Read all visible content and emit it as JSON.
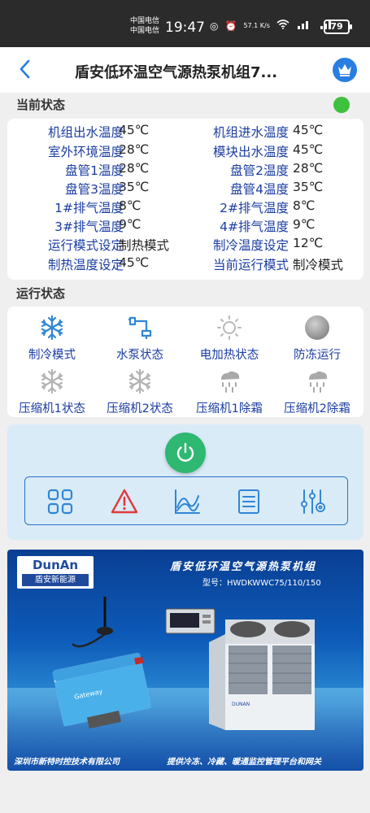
{
  "statusbar": {
    "carrier1": "中国电信",
    "carrier2": "中国电信",
    "time": "19:47",
    "speed": "57.1 K/s",
    "battery": "79"
  },
  "header": {
    "back_icon": "chevron-left-icon",
    "title": "盾安低环温空气源热泵机组7...",
    "crown_icon": "crown-icon"
  },
  "current_status": {
    "title": "当前状态",
    "online_color": "#3ec13e",
    "rows": [
      {
        "l1": "机组出水温度",
        "v1": "45℃",
        "l2": "机组进水温度",
        "v2": "45℃"
      },
      {
        "l1": "室外环境温度",
        "v1": "28℃",
        "l2": "模块出水温度",
        "v2": "45℃"
      },
      {
        "l1": "盘管1温度",
        "v1": "28℃",
        "l2": "盘管2温度",
        "v2": "28℃"
      },
      {
        "l1": "盘管3温度",
        "v1": "35℃",
        "l2": "盘管4温度",
        "v2": "35℃"
      },
      {
        "l1": "1#排气温度",
        "v1": "8℃",
        "l2": "2#排气温度",
        "v2": "8℃"
      },
      {
        "l1": "3#排气温度",
        "v1": "9℃",
        "l2": "4#排气温度",
        "v2": "9℃"
      },
      {
        "l1": "运行模式设定",
        "v1": "制热模式",
        "l2": "制冷温度设定",
        "v2": "12℃"
      },
      {
        "l1": "制热温度设定",
        "v1": "45℃",
        "l2": "当前运行模式",
        "v2": "制冷模式"
      }
    ]
  },
  "run_status": {
    "title": "运行状态",
    "items": [
      {
        "label": "制冷模式",
        "icon": "snowflake-icon",
        "active": true
      },
      {
        "label": "水泵状态",
        "icon": "water-pump-icon",
        "active": true
      },
      {
        "label": "电加热状态",
        "icon": "sun-icon",
        "active": false
      },
      {
        "label": "防冻运行",
        "icon": "circle-icon",
        "active": false
      },
      {
        "label": "压缩机1状态",
        "icon": "snowflake-icon",
        "active": false
      },
      {
        "label": "压缩机2状态",
        "icon": "snowflake-icon",
        "active": false
      },
      {
        "label": "压缩机1除霜",
        "icon": "defrost-icon",
        "active": false
      },
      {
        "label": "压缩机2除霜",
        "icon": "defrost-icon",
        "active": false
      }
    ]
  },
  "control": {
    "power_icon": "power-icon",
    "power_color": "#2eb872",
    "toolbar": [
      "grid-icon",
      "alarm-warning-icon",
      "trend-chart-icon",
      "list-icon",
      "settings-sliders-icon"
    ]
  },
  "banner": {
    "logo_en": "DunAn",
    "logo_cn": "盾安新能源",
    "title": "盾安低环温空气源热泵机组",
    "model": "型号：HWDKWWC75/110/150",
    "device_brand": "Gateway",
    "unit_brand": "DUNAN",
    "footer_left": "深圳市新特时控技术有限公司",
    "footer_right": "提供冷冻、冷藏、暖通监控管理平台和网关"
  }
}
